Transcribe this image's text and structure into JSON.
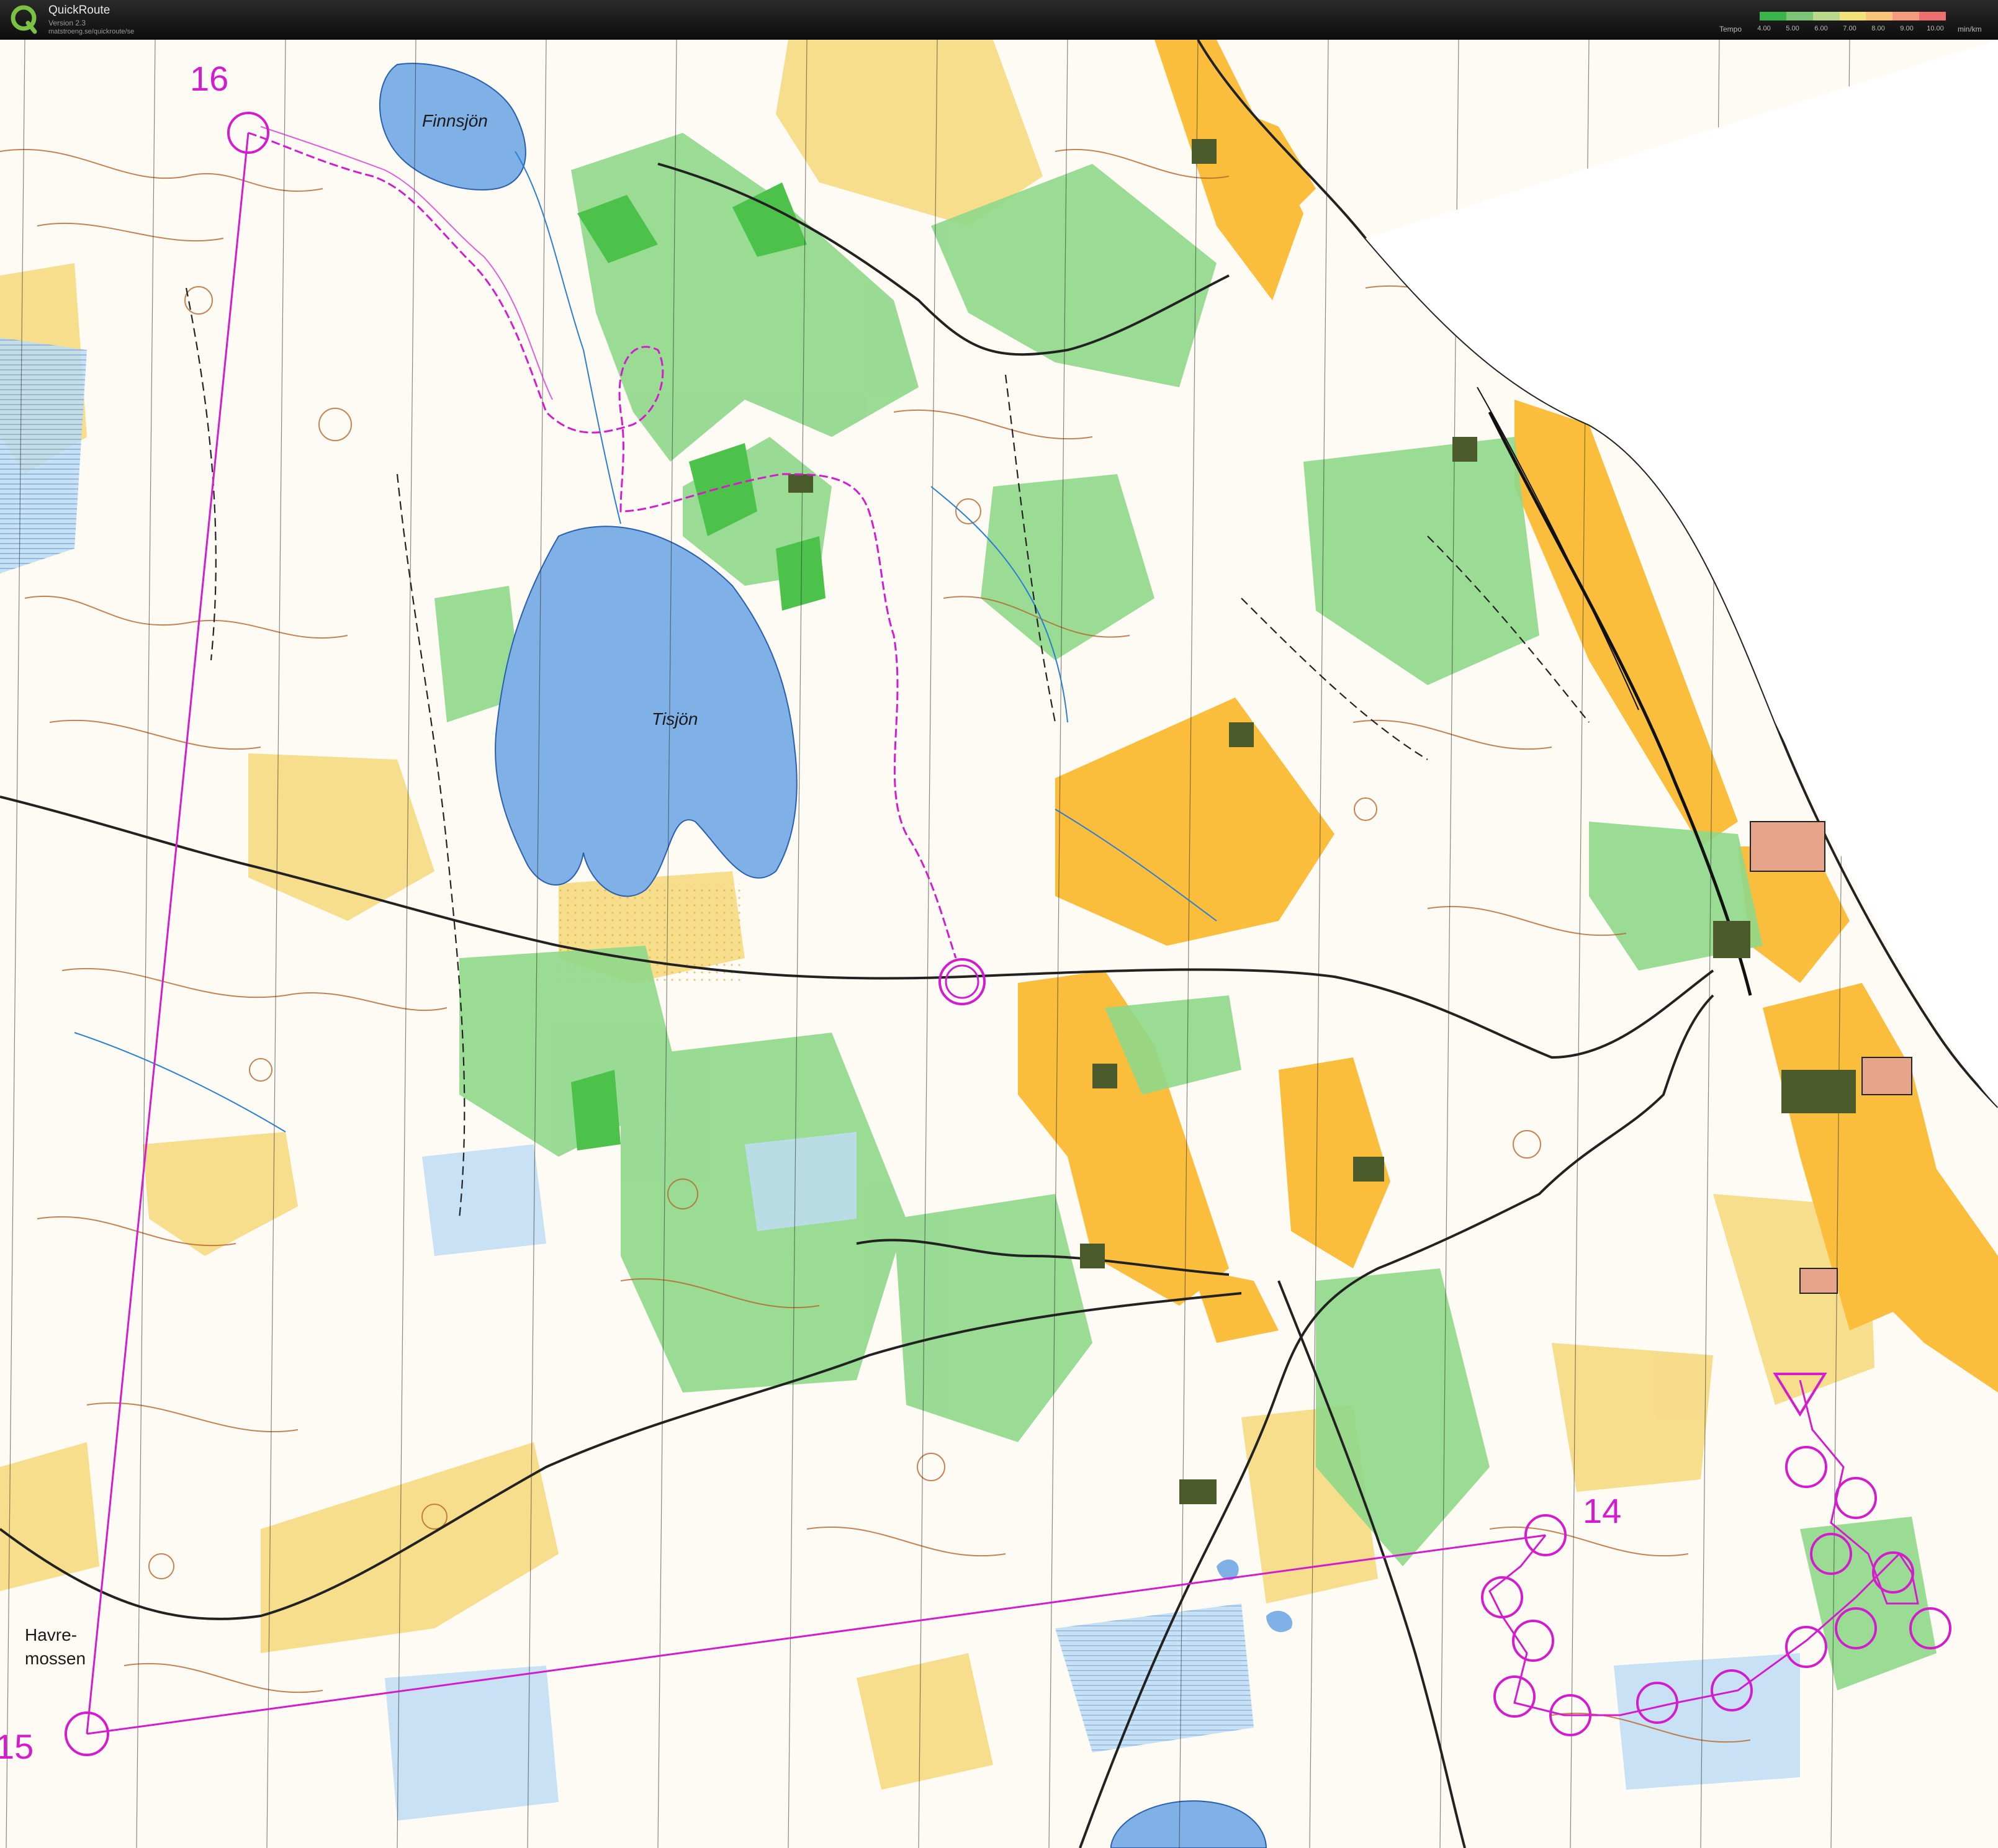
{
  "app": {
    "title": "QuickRoute",
    "version": "Version 2.3",
    "url": "matstroeng.se/quickroute/se"
  },
  "legend": {
    "label": "Tempo",
    "ticks": [
      "4.00",
      "5.00",
      "6.00",
      "7.00",
      "8.00",
      "9.00",
      "10.00"
    ],
    "unit": "min/km",
    "colors": [
      "#39b54a",
      "#7cc576",
      "#b8d98a",
      "#f2e27a",
      "#f7c47a",
      "#f39b7f",
      "#ee6f6f"
    ]
  },
  "map": {
    "place_names": {
      "finnsjon": "Finnsjön",
      "tisjon": "Tisjön",
      "havremossen_1": "Havre-",
      "havremossen_2": "mossen"
    },
    "controls": {
      "c14": "14",
      "c15": "15",
      "c16": "16"
    },
    "colors": {
      "course": "#d21ccd",
      "water": "#7fb0e6",
      "open_land": "#fbbf3e",
      "rough_open": "#f6d97a",
      "forest_green": "#7fd17a",
      "contour": "#b5652b",
      "road": "#222222"
    }
  }
}
